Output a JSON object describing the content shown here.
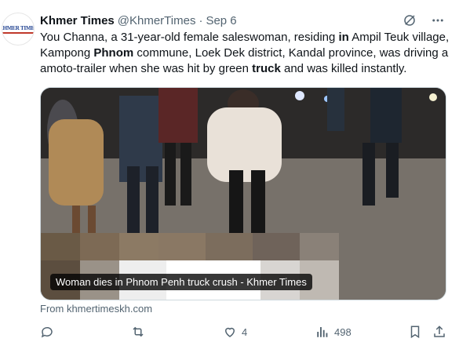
{
  "tweet": {
    "avatar_text": "KHMER TIMES",
    "display_name": "Khmer Times",
    "handle": "@KhmerTimes",
    "separator": "·",
    "timestamp": "Sep 6",
    "text_segments": [
      {
        "t": "You Channa, a 31-year-old female saleswoman, residing ",
        "b": false
      },
      {
        "t": "in",
        "b": true
      },
      {
        "t": " Ampil Teuk village, Kampong ",
        "b": false
      },
      {
        "t": "Phnom",
        "b": true
      },
      {
        "t": " commune, Loek Dek district, Kandal province, was driving a amoto-trailer when she was hit by green ",
        "b": false
      },
      {
        "t": "truck",
        "b": true
      },
      {
        "t": " and was killed instantly.",
        "b": false
      }
    ]
  },
  "media": {
    "caption": "Woman dies in Phnom Penh truck crush - Khmer Times"
  },
  "source": {
    "label": "From khmertimeskh.com"
  },
  "actions": {
    "reply_count": "",
    "retweet_count": "",
    "like_count": "4",
    "views_count": "498"
  },
  "icons": {
    "grok": "grok-icon",
    "more": "more-icon",
    "reply": "reply-icon",
    "retweet": "retweet-icon",
    "like": "heart-icon",
    "views": "views-icon",
    "bookmark": "bookmark-icon",
    "share": "share-icon"
  },
  "colors": {
    "text": "#0f1419",
    "secondary": "#536471",
    "border": "#cfd9de"
  }
}
